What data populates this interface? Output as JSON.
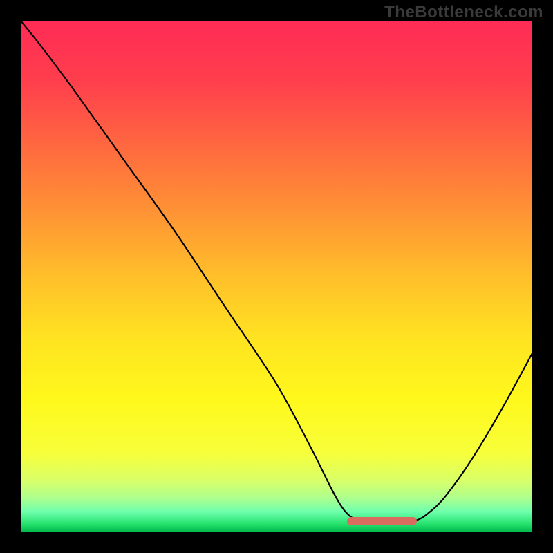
{
  "watermark": "TheBottleneck.com",
  "chart_data": {
    "type": "line",
    "title": "",
    "xlabel": "",
    "ylabel": "",
    "xlim": [
      0,
      100
    ],
    "ylim": [
      0,
      100
    ],
    "background_gradient": {
      "stops": [
        {
          "pos": 0.0,
          "color": "#ff2b55"
        },
        {
          "pos": 0.12,
          "color": "#ff3f4d"
        },
        {
          "pos": 0.25,
          "color": "#ff6a3f"
        },
        {
          "pos": 0.38,
          "color": "#ff9534"
        },
        {
          "pos": 0.5,
          "color": "#ffbf2a"
        },
        {
          "pos": 0.62,
          "color": "#ffe321"
        },
        {
          "pos": 0.74,
          "color": "#fff81c"
        },
        {
          "pos": 0.845,
          "color": "#f7ff3a"
        },
        {
          "pos": 0.9,
          "color": "#d8ff6a"
        },
        {
          "pos": 0.935,
          "color": "#aaff90"
        },
        {
          "pos": 0.96,
          "color": "#6effad"
        },
        {
          "pos": 0.985,
          "color": "#22e06a"
        },
        {
          "pos": 1.0,
          "color": "#00b64a"
        }
      ]
    },
    "series": [
      {
        "name": "bottleneck-curve",
        "color": "#000000",
        "width": 2.2,
        "points": [
          {
            "x": 0,
            "y": 100
          },
          {
            "x": 4,
            "y": 95
          },
          {
            "x": 10,
            "y": 87
          },
          {
            "x": 20,
            "y": 73
          },
          {
            "x": 30,
            "y": 59
          },
          {
            "x": 40,
            "y": 44
          },
          {
            "x": 50,
            "y": 29
          },
          {
            "x": 57,
            "y": 16
          },
          {
            "x": 61,
            "y": 8
          },
          {
            "x": 63.5,
            "y": 4
          },
          {
            "x": 66,
            "y": 2.3
          },
          {
            "x": 70,
            "y": 2.0
          },
          {
            "x": 74,
            "y": 2.0
          },
          {
            "x": 77.5,
            "y": 2.4
          },
          {
            "x": 80,
            "y": 4
          },
          {
            "x": 83,
            "y": 7
          },
          {
            "x": 88,
            "y": 14
          },
          {
            "x": 94,
            "y": 24
          },
          {
            "x": 100,
            "y": 35
          }
        ]
      }
    ],
    "marker_segment": {
      "name": "optimal-zone",
      "color": "#d96b5f",
      "thickness": 12,
      "y": 2.1,
      "x_start": 63.8,
      "x_end": 77.5
    }
  }
}
